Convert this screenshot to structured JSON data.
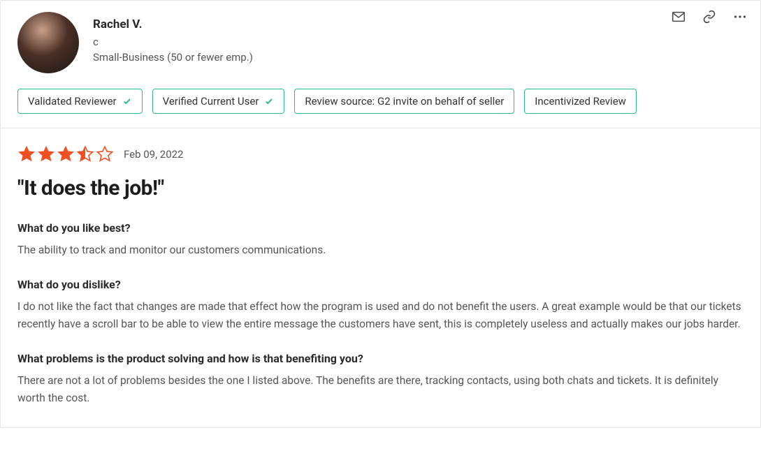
{
  "reviewer": {
    "name": "Rachel V.",
    "role": "c",
    "company": "Small-Business (50 or fewer emp.)"
  },
  "badges": [
    {
      "label": "Validated Reviewer",
      "check": true
    },
    {
      "label": "Verified Current User",
      "check": true
    },
    {
      "label": "Review source: G2 invite on behalf of seller",
      "check": false
    },
    {
      "label": "Incentivized Review",
      "check": false
    }
  ],
  "rating": {
    "value": 3.5,
    "max": 5
  },
  "date": "Feb 09, 2022",
  "title": "\"It does the job!\"",
  "qa": [
    {
      "q": "What do you like best?",
      "a": "The ability to track and monitor our customers communications."
    },
    {
      "q": "What do you dislike?",
      "a": "I do not like the fact that changes are made that effect how the program is used and do not benefit the users. A great example would be that our tickets recently have a scroll bar to be able to view the entire message the customers have sent, this is completely useless and actually makes our jobs harder."
    },
    {
      "q": "What problems is the product solving and how is that benefiting you?",
      "a": "There are not a lot of problems besides the one I listed above. The benefits are there, tracking contacts, using both chats and tickets. It is definitely worth the cost."
    }
  ]
}
